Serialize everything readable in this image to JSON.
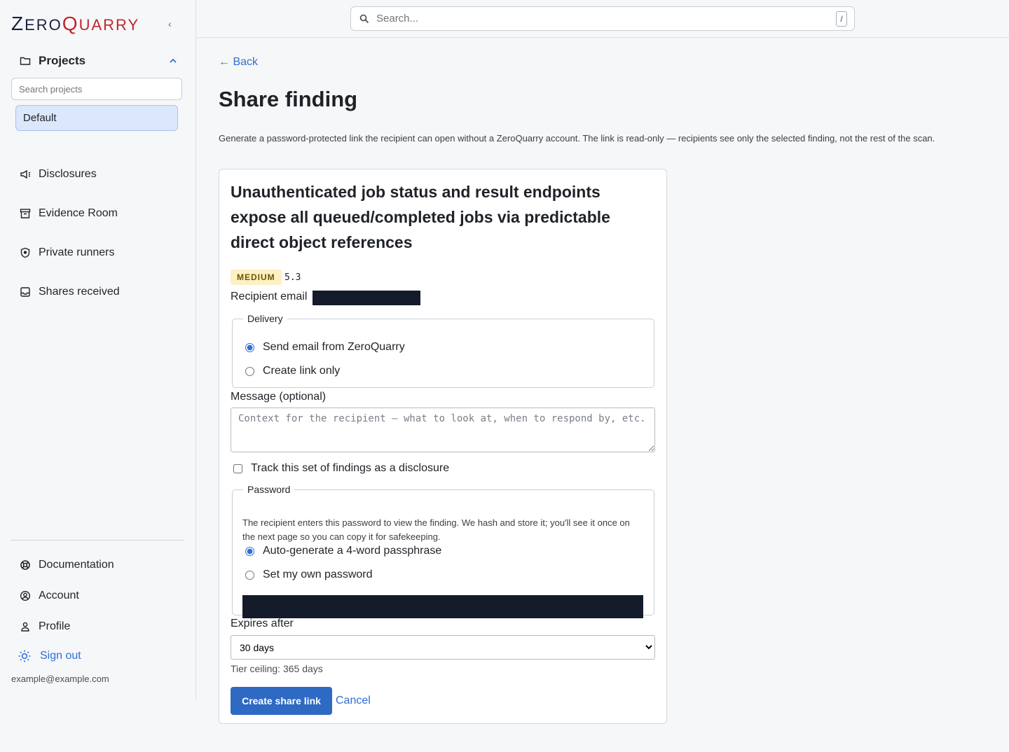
{
  "brand": {
    "part1": "Z",
    "part2": "ERO",
    "part3": "Q",
    "part4": "UARRY",
    "accent": "#c0262d",
    "dark": "#1b2140"
  },
  "sidebar": {
    "collapse": "‹",
    "projects_label": "Projects",
    "search_placeholder": "Search projects",
    "selected_project": "Default",
    "nav": [
      {
        "label": "Disclosures",
        "icon": "megaphone-icon"
      },
      {
        "label": "Evidence Room",
        "icon": "archive-icon"
      },
      {
        "label": "Private runners",
        "icon": "shield-icon"
      },
      {
        "label": "Shares received",
        "icon": "inbox-icon"
      }
    ],
    "footer": [
      {
        "label": "Documentation",
        "icon": "lifebuoy-icon"
      },
      {
        "label": "Account",
        "icon": "user-circle-icon"
      },
      {
        "label": "Profile",
        "icon": "user-icon"
      },
      {
        "label": "Sign out",
        "icon": "sun-icon"
      }
    ],
    "user_email": "example@example.com"
  },
  "topbar": {
    "search_placeholder": "Search...",
    "shortcut": "/"
  },
  "page": {
    "back": "← Back",
    "title": "Share finding",
    "intro": "Generate a password-protected link the recipient can open without a ZeroQuarry account. The link is read-only — recipients see only the selected finding, not the rest of the scan."
  },
  "finding": {
    "title": "Unauthenticated job status and result endpoints expose all queued/completed jobs via predictable direct object references",
    "severity": "MEDIUM",
    "score": "5.3"
  },
  "form": {
    "recipient_label": "Recipient email",
    "delivery_legend": "Delivery",
    "delivery_options": [
      "Send email from ZeroQuarry",
      "Create link only"
    ],
    "message_label": "Message (optional)",
    "message_placeholder": "Context for the recipient — what to look at, when to respond by, etc.",
    "track_label": "Track this set of findings as a disclosure",
    "password_legend": "Password",
    "password_help": "The recipient enters this password to view the finding. We hash and store it; you'll see it once on the next page so you can copy it for safekeeping.",
    "password_options": [
      "Auto-generate a 4-word passphrase",
      "Set my own password"
    ],
    "expires_label": "Expires after",
    "expires_value": "30 days",
    "tier_note": "Tier ceiling: 365 days",
    "submit": "Create share link",
    "cancel": "Cancel"
  }
}
